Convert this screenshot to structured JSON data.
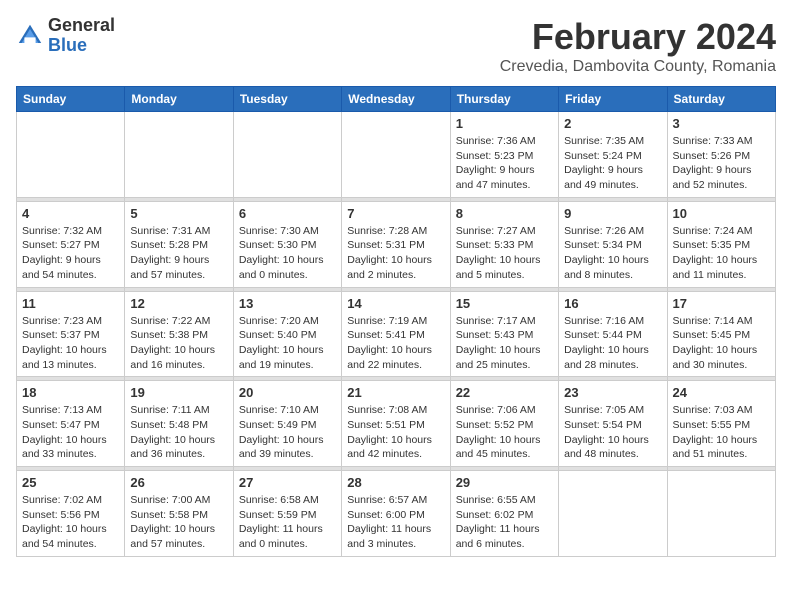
{
  "header": {
    "logo_general": "General",
    "logo_blue": "Blue",
    "month_title": "February 2024",
    "subtitle": "Crevedia, Dambovita County, Romania"
  },
  "weekdays": [
    "Sunday",
    "Monday",
    "Tuesday",
    "Wednesday",
    "Thursday",
    "Friday",
    "Saturday"
  ],
  "weeks": [
    [
      {
        "day": "",
        "info": ""
      },
      {
        "day": "",
        "info": ""
      },
      {
        "day": "",
        "info": ""
      },
      {
        "day": "",
        "info": ""
      },
      {
        "day": "1",
        "info": "Sunrise: 7:36 AM\nSunset: 5:23 PM\nDaylight: 9 hours\nand 47 minutes."
      },
      {
        "day": "2",
        "info": "Sunrise: 7:35 AM\nSunset: 5:24 PM\nDaylight: 9 hours\nand 49 minutes."
      },
      {
        "day": "3",
        "info": "Sunrise: 7:33 AM\nSunset: 5:26 PM\nDaylight: 9 hours\nand 52 minutes."
      }
    ],
    [
      {
        "day": "4",
        "info": "Sunrise: 7:32 AM\nSunset: 5:27 PM\nDaylight: 9 hours\nand 54 minutes."
      },
      {
        "day": "5",
        "info": "Sunrise: 7:31 AM\nSunset: 5:28 PM\nDaylight: 9 hours\nand 57 minutes."
      },
      {
        "day": "6",
        "info": "Sunrise: 7:30 AM\nSunset: 5:30 PM\nDaylight: 10 hours\nand 0 minutes."
      },
      {
        "day": "7",
        "info": "Sunrise: 7:28 AM\nSunset: 5:31 PM\nDaylight: 10 hours\nand 2 minutes."
      },
      {
        "day": "8",
        "info": "Sunrise: 7:27 AM\nSunset: 5:33 PM\nDaylight: 10 hours\nand 5 minutes."
      },
      {
        "day": "9",
        "info": "Sunrise: 7:26 AM\nSunset: 5:34 PM\nDaylight: 10 hours\nand 8 minutes."
      },
      {
        "day": "10",
        "info": "Sunrise: 7:24 AM\nSunset: 5:35 PM\nDaylight: 10 hours\nand 11 minutes."
      }
    ],
    [
      {
        "day": "11",
        "info": "Sunrise: 7:23 AM\nSunset: 5:37 PM\nDaylight: 10 hours\nand 13 minutes."
      },
      {
        "day": "12",
        "info": "Sunrise: 7:22 AM\nSunset: 5:38 PM\nDaylight: 10 hours\nand 16 minutes."
      },
      {
        "day": "13",
        "info": "Sunrise: 7:20 AM\nSunset: 5:40 PM\nDaylight: 10 hours\nand 19 minutes."
      },
      {
        "day": "14",
        "info": "Sunrise: 7:19 AM\nSunset: 5:41 PM\nDaylight: 10 hours\nand 22 minutes."
      },
      {
        "day": "15",
        "info": "Sunrise: 7:17 AM\nSunset: 5:43 PM\nDaylight: 10 hours\nand 25 minutes."
      },
      {
        "day": "16",
        "info": "Sunrise: 7:16 AM\nSunset: 5:44 PM\nDaylight: 10 hours\nand 28 minutes."
      },
      {
        "day": "17",
        "info": "Sunrise: 7:14 AM\nSunset: 5:45 PM\nDaylight: 10 hours\nand 30 minutes."
      }
    ],
    [
      {
        "day": "18",
        "info": "Sunrise: 7:13 AM\nSunset: 5:47 PM\nDaylight: 10 hours\nand 33 minutes."
      },
      {
        "day": "19",
        "info": "Sunrise: 7:11 AM\nSunset: 5:48 PM\nDaylight: 10 hours\nand 36 minutes."
      },
      {
        "day": "20",
        "info": "Sunrise: 7:10 AM\nSunset: 5:49 PM\nDaylight: 10 hours\nand 39 minutes."
      },
      {
        "day": "21",
        "info": "Sunrise: 7:08 AM\nSunset: 5:51 PM\nDaylight: 10 hours\nand 42 minutes."
      },
      {
        "day": "22",
        "info": "Sunrise: 7:06 AM\nSunset: 5:52 PM\nDaylight: 10 hours\nand 45 minutes."
      },
      {
        "day": "23",
        "info": "Sunrise: 7:05 AM\nSunset: 5:54 PM\nDaylight: 10 hours\nand 48 minutes."
      },
      {
        "day": "24",
        "info": "Sunrise: 7:03 AM\nSunset: 5:55 PM\nDaylight: 10 hours\nand 51 minutes."
      }
    ],
    [
      {
        "day": "25",
        "info": "Sunrise: 7:02 AM\nSunset: 5:56 PM\nDaylight: 10 hours\nand 54 minutes."
      },
      {
        "day": "26",
        "info": "Sunrise: 7:00 AM\nSunset: 5:58 PM\nDaylight: 10 hours\nand 57 minutes."
      },
      {
        "day": "27",
        "info": "Sunrise: 6:58 AM\nSunset: 5:59 PM\nDaylight: 11 hours\nand 0 minutes."
      },
      {
        "day": "28",
        "info": "Sunrise: 6:57 AM\nSunset: 6:00 PM\nDaylight: 11 hours\nand 3 minutes."
      },
      {
        "day": "29",
        "info": "Sunrise: 6:55 AM\nSunset: 6:02 PM\nDaylight: 11 hours\nand 6 minutes."
      },
      {
        "day": "",
        "info": ""
      },
      {
        "day": "",
        "info": ""
      }
    ]
  ]
}
